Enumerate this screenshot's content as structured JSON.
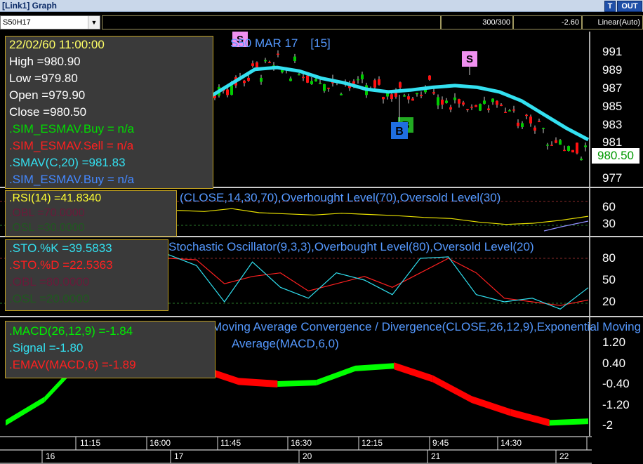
{
  "window": {
    "title": "[Link1] Graph",
    "btn_t": "T",
    "btn_out": "OUT"
  },
  "toolbar": {
    "symbol": "S50H17",
    "counter": "300/300",
    "offset": "-2.60",
    "scale": "Linear(Auto)"
  },
  "price_panel": {
    "title": "S50 MAR 17",
    "interval": "[15]",
    "info": {
      "datetime": "22/02/60 11:00:00",
      "high": "High  =980.90",
      "low": "Low  =979.80",
      "open": "Open  =979.90",
      "close": "Close  =980.50",
      "esmav_buy": ".SIM_ESMAV.Buy    = n/a",
      "esmav_sell": ".SIM_ESMAV.Sell    = n/a",
      "smav": ".SMAV(C,20)    =981.83",
      "esmav_buy2": ".SIM_ESMAV.Buy    = n/a"
    },
    "y_ticks": [
      "991",
      "989",
      "987",
      "985",
      "983",
      "981",
      "977"
    ],
    "last_price": "980.50",
    "signals": {
      "s1": "S",
      "s2": "S",
      "b1": "B",
      "b2": "B"
    }
  },
  "rsi_panel": {
    "title": "(CLOSE,14,30,70),Overbought Level(70),Oversold Level(30)",
    "info": {
      "rsi": ".RSI(14)    =41.8340",
      "obl": ".OBL    =70.0000",
      "osl": ".OSL    =30.0000"
    },
    "y_ticks": [
      "60",
      "30"
    ]
  },
  "sto_panel": {
    "title": "Stochastic Oscillator(9,3,3),Overbought Level(80),Oversold Level(20)",
    "info": {
      "k": ".STO.%K    =39.5833",
      "d": ".STO.%D    =22.5363",
      "obl": ".OBL    =80.0000",
      "osl": ".OSL    =20.0000"
    },
    "y_ticks": [
      "80",
      "50",
      "20"
    ]
  },
  "macd_panel": {
    "title_line1": "Moving Average Convergence / Divergence(CLOSE,26,12,9),Exponential Moving",
    "title_line2": "Average(MACD,6,0)",
    "info": {
      "macd": ".MACD(26,12,9)    =-1.84",
      "signal": ".Signal    =-1.80",
      "emav": ".EMAV(MACD,6)    =-1.89"
    },
    "y_ticks": [
      "1.20",
      "0.40",
      "-0.40",
      "-1.20",
      "-2"
    ]
  },
  "time_axis": {
    "times": [
      "11:15",
      "16:00",
      "11:45",
      "16:30",
      "12:15",
      "9:45",
      "14:30"
    ],
    "days": [
      "16",
      "17",
      "20",
      "21",
      "22"
    ]
  },
  "colors": {
    "smav": "#33e0f0",
    "up": "#00cc00",
    "down": "#ff1010",
    "rsi": "#e8e000",
    "stok": "#30e0f0",
    "stod": "#ff2020",
    "macd_up": "#00ff00",
    "macd_dn": "#ff0000"
  },
  "chart_data": {
    "type": "line",
    "title": "S50 MAR 17",
    "series": [
      {
        "name": ".SMAV(C,20)",
        "values": [
          986,
          987.5,
          989,
          989.2,
          988.8,
          988,
          987.5,
          986.8,
          986.5,
          986.7,
          987,
          987.2,
          987,
          986.5,
          985.5,
          984,
          982.5,
          981.2
        ]
      },
      {
        "name": ".RSI(14)",
        "values": [
          52,
          50,
          55,
          48,
          46,
          44,
          47,
          45,
          43,
          40,
          38,
          32,
          28,
          30,
          35,
          41.834
        ]
      },
      {
        "name": ".STO.%K",
        "values": [
          85,
          70,
          20,
          75,
          40,
          25,
          60,
          50,
          30,
          80,
          82,
          30,
          20,
          25,
          10,
          39.58
        ]
      },
      {
        "name": ".STO.%D",
        "values": [
          80,
          78,
          45,
          55,
          60,
          35,
          45,
          55,
          40,
          60,
          80,
          60,
          25,
          20,
          15,
          22.54
        ]
      },
      {
        "name": ".MACD(26,12,9)",
        "values": [
          -1.9,
          -1.0,
          0.6,
          1.3,
          1.0,
          0.2,
          -0.3,
          -0.4,
          -0.35,
          0.2,
          0.3,
          -0.2,
          -1.0,
          -1.5,
          -1.9,
          -1.84
        ]
      }
    ]
  }
}
